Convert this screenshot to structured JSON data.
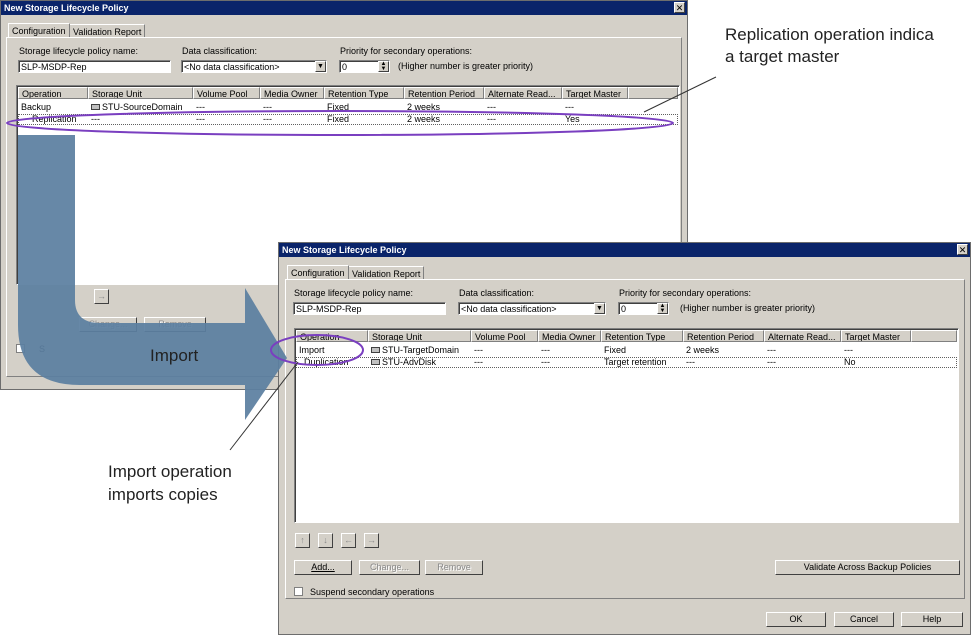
{
  "annotations": {
    "top_right": "Replication operation indica",
    "top_right_line2": "a target master",
    "import_label": "Import",
    "bottom_left_line1": "Import operation",
    "bottom_left_line2": "imports copies"
  },
  "back_window": {
    "title": "New Storage Lifecycle Policy",
    "tabs": [
      "Configuration",
      "Validation Report"
    ],
    "policy_name_label": "Storage lifecycle policy name:",
    "policy_name_value": "SLP-MSDP-Rep",
    "data_class_label": "Data classification:",
    "data_class_value": "<No data classification>",
    "priority_label": "Priority for secondary operations:",
    "priority_value": "0",
    "priority_hint": "(Higher number is greater priority)",
    "columns": [
      "Operation",
      "Storage Unit",
      "Volume Pool",
      "Media Owner",
      "Retention Type",
      "Retention Period",
      "Alternate Read...",
      "Target Master"
    ],
    "rows": [
      [
        "Backup",
        "STU-SourceDomain",
        "---",
        "---",
        "Fixed",
        "2 weeks",
        "---",
        "---"
      ],
      [
        "Replication",
        "---",
        "---",
        "---",
        "Fixed",
        "2 weeks",
        "---",
        "Yes"
      ]
    ],
    "buttons": {
      "change": "Change...",
      "remove": "Remove"
    },
    "suspend_label": "S"
  },
  "front_window": {
    "title": "New Storage Lifecycle Policy",
    "tabs": [
      "Configuration",
      "Validation Report"
    ],
    "policy_name_label": "Storage lifecycle policy name:",
    "policy_name_value": "SLP-MSDP-Rep",
    "data_class_label": "Data classification:",
    "data_class_value": "<No data classification>",
    "priority_label": "Priority for secondary operations:",
    "priority_value": "0",
    "priority_hint": "(Higher number is greater priority)",
    "columns": [
      "Operation",
      "Storage Unit",
      "Volume Pool",
      "Media Owner",
      "Retention Type",
      "Retention Period",
      "Alternate Read...",
      "Target Master"
    ],
    "rows": [
      [
        "Import",
        "STU-TargetDomain",
        "---",
        "---",
        "Fixed",
        "2 weeks",
        "---",
        "---"
      ],
      [
        "Duplication",
        "STU-AdvDisk",
        "---",
        "---",
        "Target retention",
        "---",
        "---",
        "No"
      ]
    ],
    "buttons": {
      "add": "Add...",
      "change": "Change...",
      "remove": "Remove",
      "validate": "Validate Across Backup Policies",
      "ok": "OK",
      "cancel": "Cancel",
      "help": "Help"
    },
    "suspend_label": "Suspend secondary operations"
  },
  "colors": {
    "highlight_ellipse": "#7a3fc0",
    "arrow": "#5b7fa0",
    "titlebar": "#0a246a"
  },
  "icons": [
    "close-icon",
    "disk-icon",
    "arrow-up-icon",
    "arrow-down-icon",
    "arrow-left-icon",
    "arrow-right-icon",
    "dropdown-icon",
    "spinner-icon"
  ]
}
